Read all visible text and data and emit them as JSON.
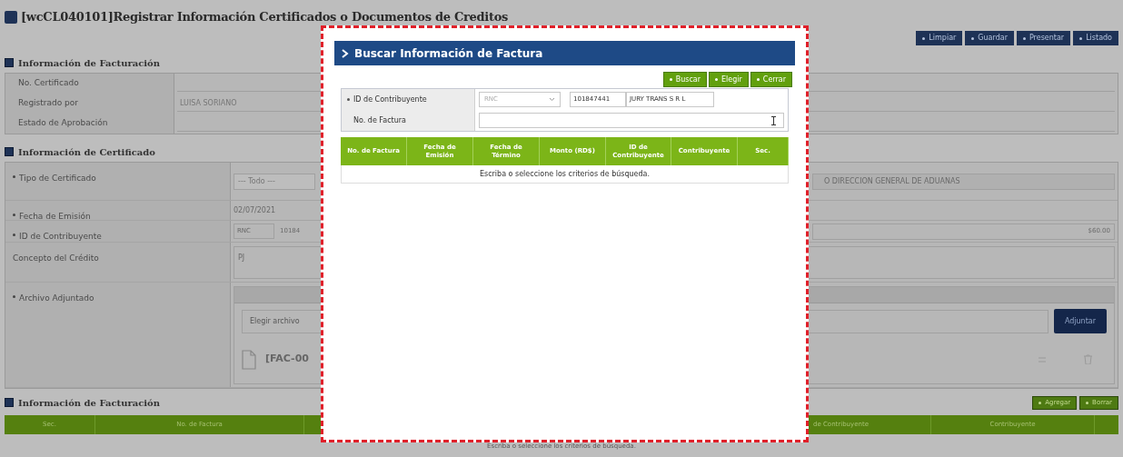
{
  "window": {
    "title": "[wcCL040101]Registrar Información Certificados o Documentos de Creditos"
  },
  "toolbar": [
    "Limpiar",
    "Guardar",
    "Presentar",
    "Listado"
  ],
  "billing_info": {
    "title": "Información de Facturación",
    "rows": [
      {
        "label": "No. Certificado"
      },
      {
        "label": "Registrado por",
        "value": "LUISA SORIANO"
      },
      {
        "label": "Estado de Aprobación"
      }
    ]
  },
  "certificate_info": {
    "title": "Información de Certificado",
    "type": {
      "label": "Tipo de Certificado",
      "required": true,
      "select": "--- Todo ---",
      "issuer": "O DIRECCION GENERAL DE ADUANAS"
    },
    "date": {
      "label": "Fecha de Emisión",
      "required": true,
      "value": "02/07/2021"
    },
    "taxpayer": {
      "label": "ID de Contribuyente",
      "required": true,
      "id_type": "RNC",
      "id": "10184",
      "amount": "$60.00"
    },
    "concept": {
      "label": "Concepto del Crédito",
      "required": false,
      "value": "PJ"
    },
    "attachment": {
      "label": "Archivo Adjuntado",
      "required": true,
      "file_field": "Elegir archivo",
      "button": "Adjuntar",
      "file_name": "[FAC-00"
    }
  },
  "invoices": {
    "title": "Información de Facturación",
    "buttons": [
      "Agregar",
      "Borrar"
    ],
    "columns": [
      "Sec.",
      "No. de Factura",
      "de Contribuyente",
      "Contribuyente"
    ],
    "empty_message": "Escriba o seleccione los criterios de búsqueda."
  },
  "dialog": {
    "title": "Buscar Información de Factura",
    "buttons": [
      "Buscar",
      "Elegir",
      "Cerrar"
    ],
    "fields": [
      {
        "label": "ID de Contribuyente",
        "required": true,
        "kind": "taxpayer",
        "id_type": "RNC",
        "id": "101847441",
        "name": "JURY TRANS S R L"
      },
      {
        "label": "No. de Factura",
        "required": false,
        "kind": "text"
      }
    ],
    "columns": [
      "No. de Factura",
      "Fecha de Emisión",
      "Fecha de Término",
      "Monto (RD$)",
      "ID de Contribuyente",
      "Contribuyente",
      "Sec."
    ],
    "empty_message": "Escriba o seleccione los criterios de búsqueda."
  }
}
